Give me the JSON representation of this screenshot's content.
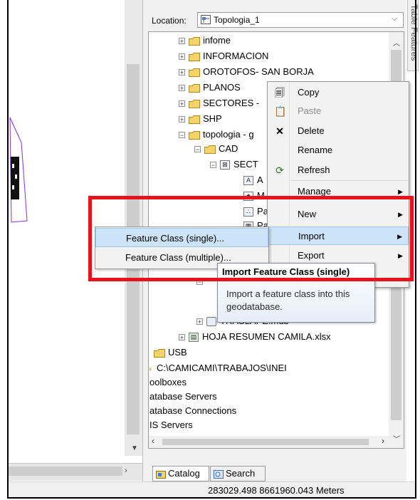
{
  "location": {
    "label": "Location:",
    "value": "Topologia_1"
  },
  "side_tab": "Table Features",
  "tree": {
    "items": [
      {
        "label": "infome"
      },
      {
        "label": "INFORMACION"
      },
      {
        "label": "OROTOFOS- SAN BORJA"
      },
      {
        "label": "PLANOS"
      },
      {
        "label": "SECTORES -"
      },
      {
        "label": "SHP"
      },
      {
        "label": "topologia - g"
      },
      {
        "label": "CAD"
      },
      {
        "label": "SECT"
      },
      {
        "label": "A"
      },
      {
        "label": "M"
      },
      {
        "label": "Pa"
      },
      {
        "label": "Pa"
      },
      {
        "label": "TRASLAPE.mdb"
      },
      {
        "label": "HOJA RESUMEN CAMILA.xlsx"
      },
      {
        "label": "USB"
      },
      {
        "label": "C:\\CAMICAMI\\TRABAJOS\\INEI"
      },
      {
        "label": "oolboxes"
      },
      {
        "label": "atabase Servers"
      },
      {
        "label": "atabase Connections"
      },
      {
        "label": "IS Servers"
      }
    ]
  },
  "context_menu": {
    "items": [
      {
        "label": "Copy"
      },
      {
        "label": "Paste"
      },
      {
        "label": "Delete"
      },
      {
        "label": "Rename"
      },
      {
        "label": "Refresh"
      },
      {
        "label": "Manage"
      },
      {
        "label": "New"
      },
      {
        "label": "Import"
      },
      {
        "label": "Export"
      }
    ]
  },
  "import_submenu": {
    "items": [
      {
        "label": "Feature Class (single)..."
      },
      {
        "label": "Feature Class (multiple)..."
      }
    ]
  },
  "tooltip": {
    "title": "Import Feature Class (single)",
    "body": "Import a feature class into this geodatabase."
  },
  "tabs": [
    {
      "label": "Catalog"
    },
    {
      "label": "Search"
    }
  ],
  "status": {
    "coords": "283029.498  8661960.043 Meters"
  },
  "colors": {
    "highlight": "#e8121c",
    "menu_hover": "#cde3f7",
    "folder": "#f2c94c"
  },
  "icons": [
    "folder-icon",
    "copy-icon",
    "paste-icon",
    "delete-icon",
    "refresh-icon",
    "catalog-icon",
    "search-icon",
    "plus-icon",
    "minus-icon",
    "chevron-down-icon"
  ]
}
